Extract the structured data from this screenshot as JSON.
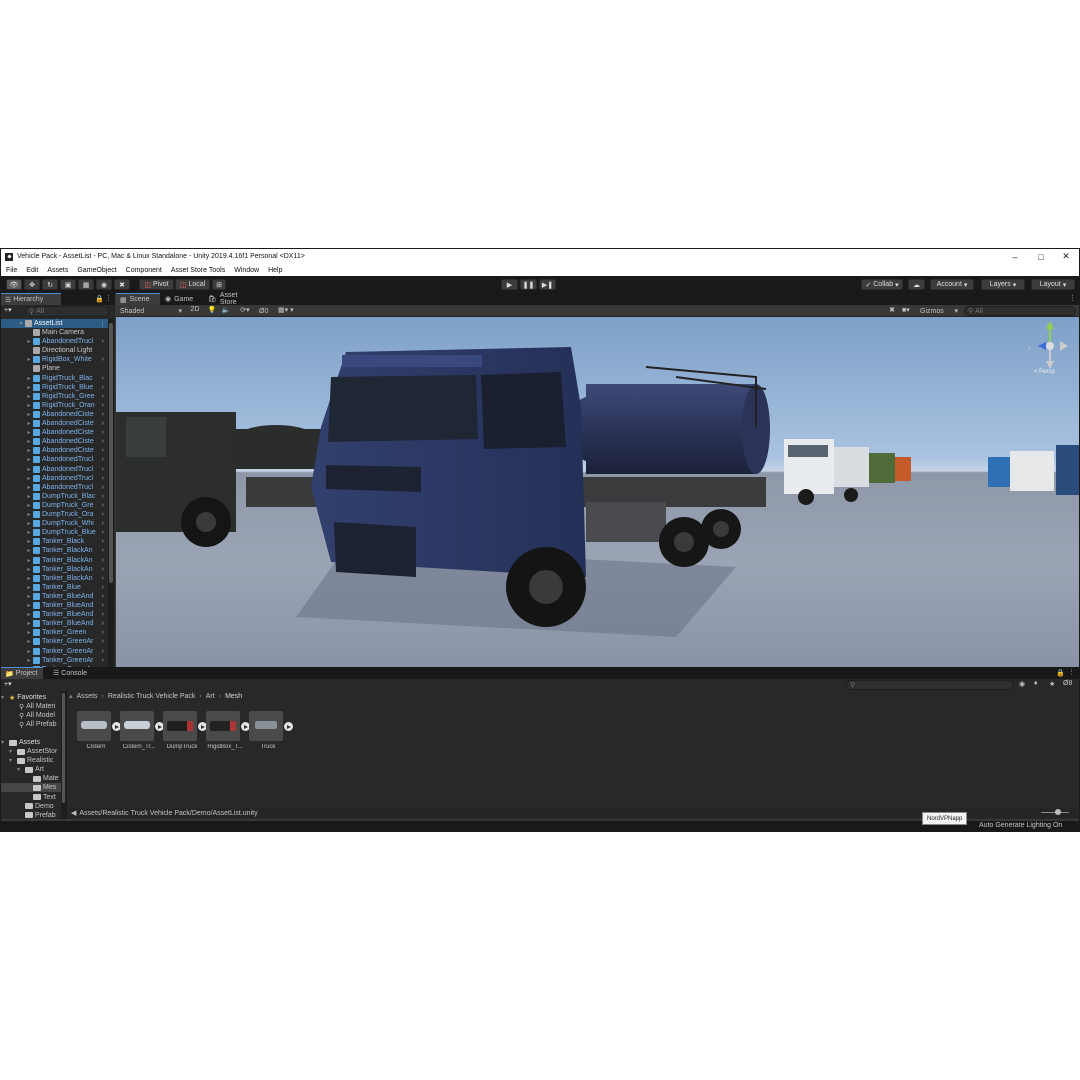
{
  "window": {
    "title": "Vehicle Pack - AssetList - PC, Mac & Linux Standalone - Unity 2019.4.16f1 Personal <DX11>"
  },
  "menu": [
    "File",
    "Edit",
    "Assets",
    "GameObject",
    "Component",
    "Asset Store Tools",
    "Window",
    "Help"
  ],
  "toolbar": {
    "pivot": "Pivot",
    "local": "Local",
    "collab": "Collab",
    "account": "Account",
    "layers": "Layers",
    "layout": "Layout"
  },
  "hierarchy": {
    "tab": "Hierarchy",
    "search_placeholder": "All",
    "root": "AssetList",
    "items": [
      {
        "label": "Main Camera",
        "kind": "plain"
      },
      {
        "label": "AbandonedTrucl",
        "kind": "prefab"
      },
      {
        "label": "Directional Light",
        "kind": "plain"
      },
      {
        "label": "RigidBox_White",
        "kind": "prefab"
      },
      {
        "label": "Plane",
        "kind": "plain"
      },
      {
        "label": "RigidTruck_Blac",
        "kind": "prefab"
      },
      {
        "label": "RigidTruck_Blue",
        "kind": "prefab"
      },
      {
        "label": "RigidTruck_Gree",
        "kind": "prefab"
      },
      {
        "label": "RigidTruck_Oran",
        "kind": "prefab"
      },
      {
        "label": "AbandonedCiste",
        "kind": "prefab"
      },
      {
        "label": "AbandonedCiste",
        "kind": "prefab"
      },
      {
        "label": "AbandonedCiste",
        "kind": "prefab"
      },
      {
        "label": "AbandonedCiste",
        "kind": "prefab"
      },
      {
        "label": "AbandonedCiste",
        "kind": "prefab"
      },
      {
        "label": "AbandonedTrucl",
        "kind": "prefab"
      },
      {
        "label": "AbandonedTrucl",
        "kind": "prefab"
      },
      {
        "label": "AbandonedTrucl",
        "kind": "prefab"
      },
      {
        "label": "AbandonedTrucl",
        "kind": "prefab"
      },
      {
        "label": "DumpTruck_Blac",
        "kind": "prefab"
      },
      {
        "label": "DumpTruck_Gre",
        "kind": "prefab"
      },
      {
        "label": "DumpTruck_Ora",
        "kind": "prefab"
      },
      {
        "label": "DumpTruck_Whi",
        "kind": "prefab"
      },
      {
        "label": "DumpTruck_Blue",
        "kind": "prefab"
      },
      {
        "label": "Tanker_Black",
        "kind": "prefab"
      },
      {
        "label": "Tanker_BlackAn",
        "kind": "prefab"
      },
      {
        "label": "Tanker_BlackAn",
        "kind": "prefab"
      },
      {
        "label": "Tanker_BlackAn",
        "kind": "prefab"
      },
      {
        "label": "Tanker_BlackAn",
        "kind": "prefab"
      },
      {
        "label": "Tanker_Blue",
        "kind": "prefab"
      },
      {
        "label": "Tanker_BlueAnd",
        "kind": "prefab"
      },
      {
        "label": "Tanker_BlueAnd",
        "kind": "prefab"
      },
      {
        "label": "Tanker_BlueAnd",
        "kind": "prefab"
      },
      {
        "label": "Tanker_BlueAnd",
        "kind": "prefab"
      },
      {
        "label": "Tanker_Green",
        "kind": "prefab"
      },
      {
        "label": "Tanker_GreenAr",
        "kind": "prefab"
      },
      {
        "label": "Tanker_GreenAr",
        "kind": "prefab"
      },
      {
        "label": "Tanker_GreenAr",
        "kind": "prefab"
      },
      {
        "label": "Tanker_GreenAr",
        "kind": "prefab"
      }
    ]
  },
  "scene": {
    "tabs": [
      "Scene",
      "Game",
      "Asset Store"
    ],
    "shading": "Shaded",
    "mode2d": "2D",
    "hidden_count": "0",
    "gizmos": "Gizmos",
    "search_placeholder": "All",
    "persp": "< Persp"
  },
  "project": {
    "tabs": [
      "Project",
      "Console"
    ],
    "favorites_label": "Favorites",
    "favorites": [
      "All Materi",
      "All Model",
      "All Prefab"
    ],
    "assets_label": "Assets",
    "tree": [
      {
        "label": "AssetStor",
        "depth": 1
      },
      {
        "label": "Realistic",
        "depth": 1
      },
      {
        "label": "Art",
        "depth": 2
      },
      {
        "label": "Mate",
        "depth": 3
      },
      {
        "label": "Mes",
        "depth": 3
      },
      {
        "label": "Text",
        "depth": 3
      },
      {
        "label": "Demo",
        "depth": 2
      },
      {
        "label": "Prefab",
        "depth": 2
      }
    ],
    "breadcrumb": [
      "Assets",
      "Realistic Truck Vehicle Pack",
      "Art",
      "Mesh"
    ],
    "assets": [
      "Cistern",
      "Cistern_Tr...",
      "DumpTruck",
      "RigidBox_T...",
      "Truck"
    ],
    "count": "8",
    "selected_path": "Assets/Realistic Truck Vehicle Pack/Demo/AssetList.unity"
  },
  "status": {
    "tooltip": "NordVPNapp",
    "lighting": "Auto Generate Lighting On"
  }
}
